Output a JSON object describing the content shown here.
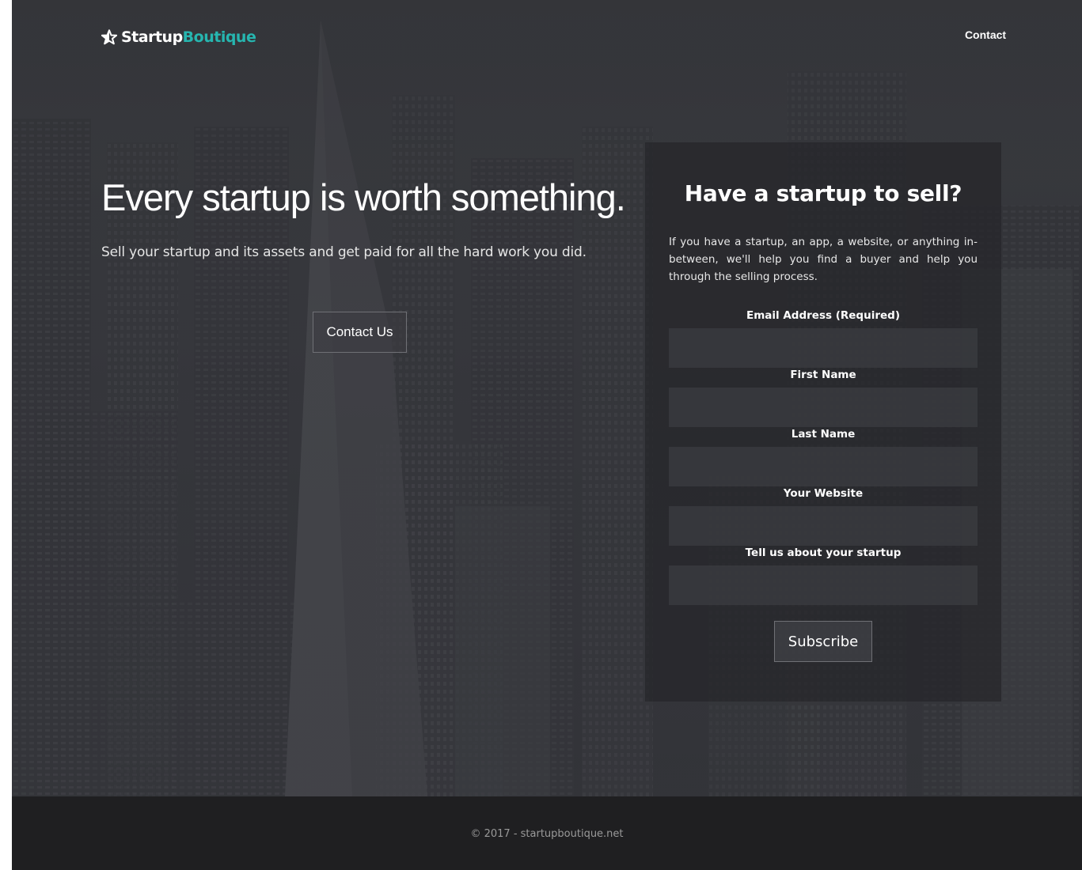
{
  "nav": {
    "brand_part1": "Startup",
    "brand_part2": "Boutique",
    "brand_icon": "star-icon",
    "contact_label": "Contact"
  },
  "hero": {
    "headline": "Every startup is worth something.",
    "subline": "Sell your startup and its assets and get paid for all the hard work you did.",
    "contact_button": "Contact Us"
  },
  "form": {
    "title": "Have a startup to sell?",
    "description": "If you have a startup, an app, a website, or anything in-between, we'll help you find a buyer and help you through the selling process.",
    "fields": [
      {
        "label": "Email Address (Required)",
        "value": ""
      },
      {
        "label": "First Name",
        "value": ""
      },
      {
        "label": "Last Name",
        "value": ""
      },
      {
        "label": "Your Website",
        "value": ""
      },
      {
        "label": "Tell us about your startup",
        "value": ""
      }
    ],
    "submit_label": "Subscribe"
  },
  "footer": {
    "text": "© 2017 - startupboutique.net"
  },
  "colors": {
    "accent": "#26b6b0",
    "footer_bg": "#1f1f21",
    "hero_overlay": "#2d2e32"
  }
}
